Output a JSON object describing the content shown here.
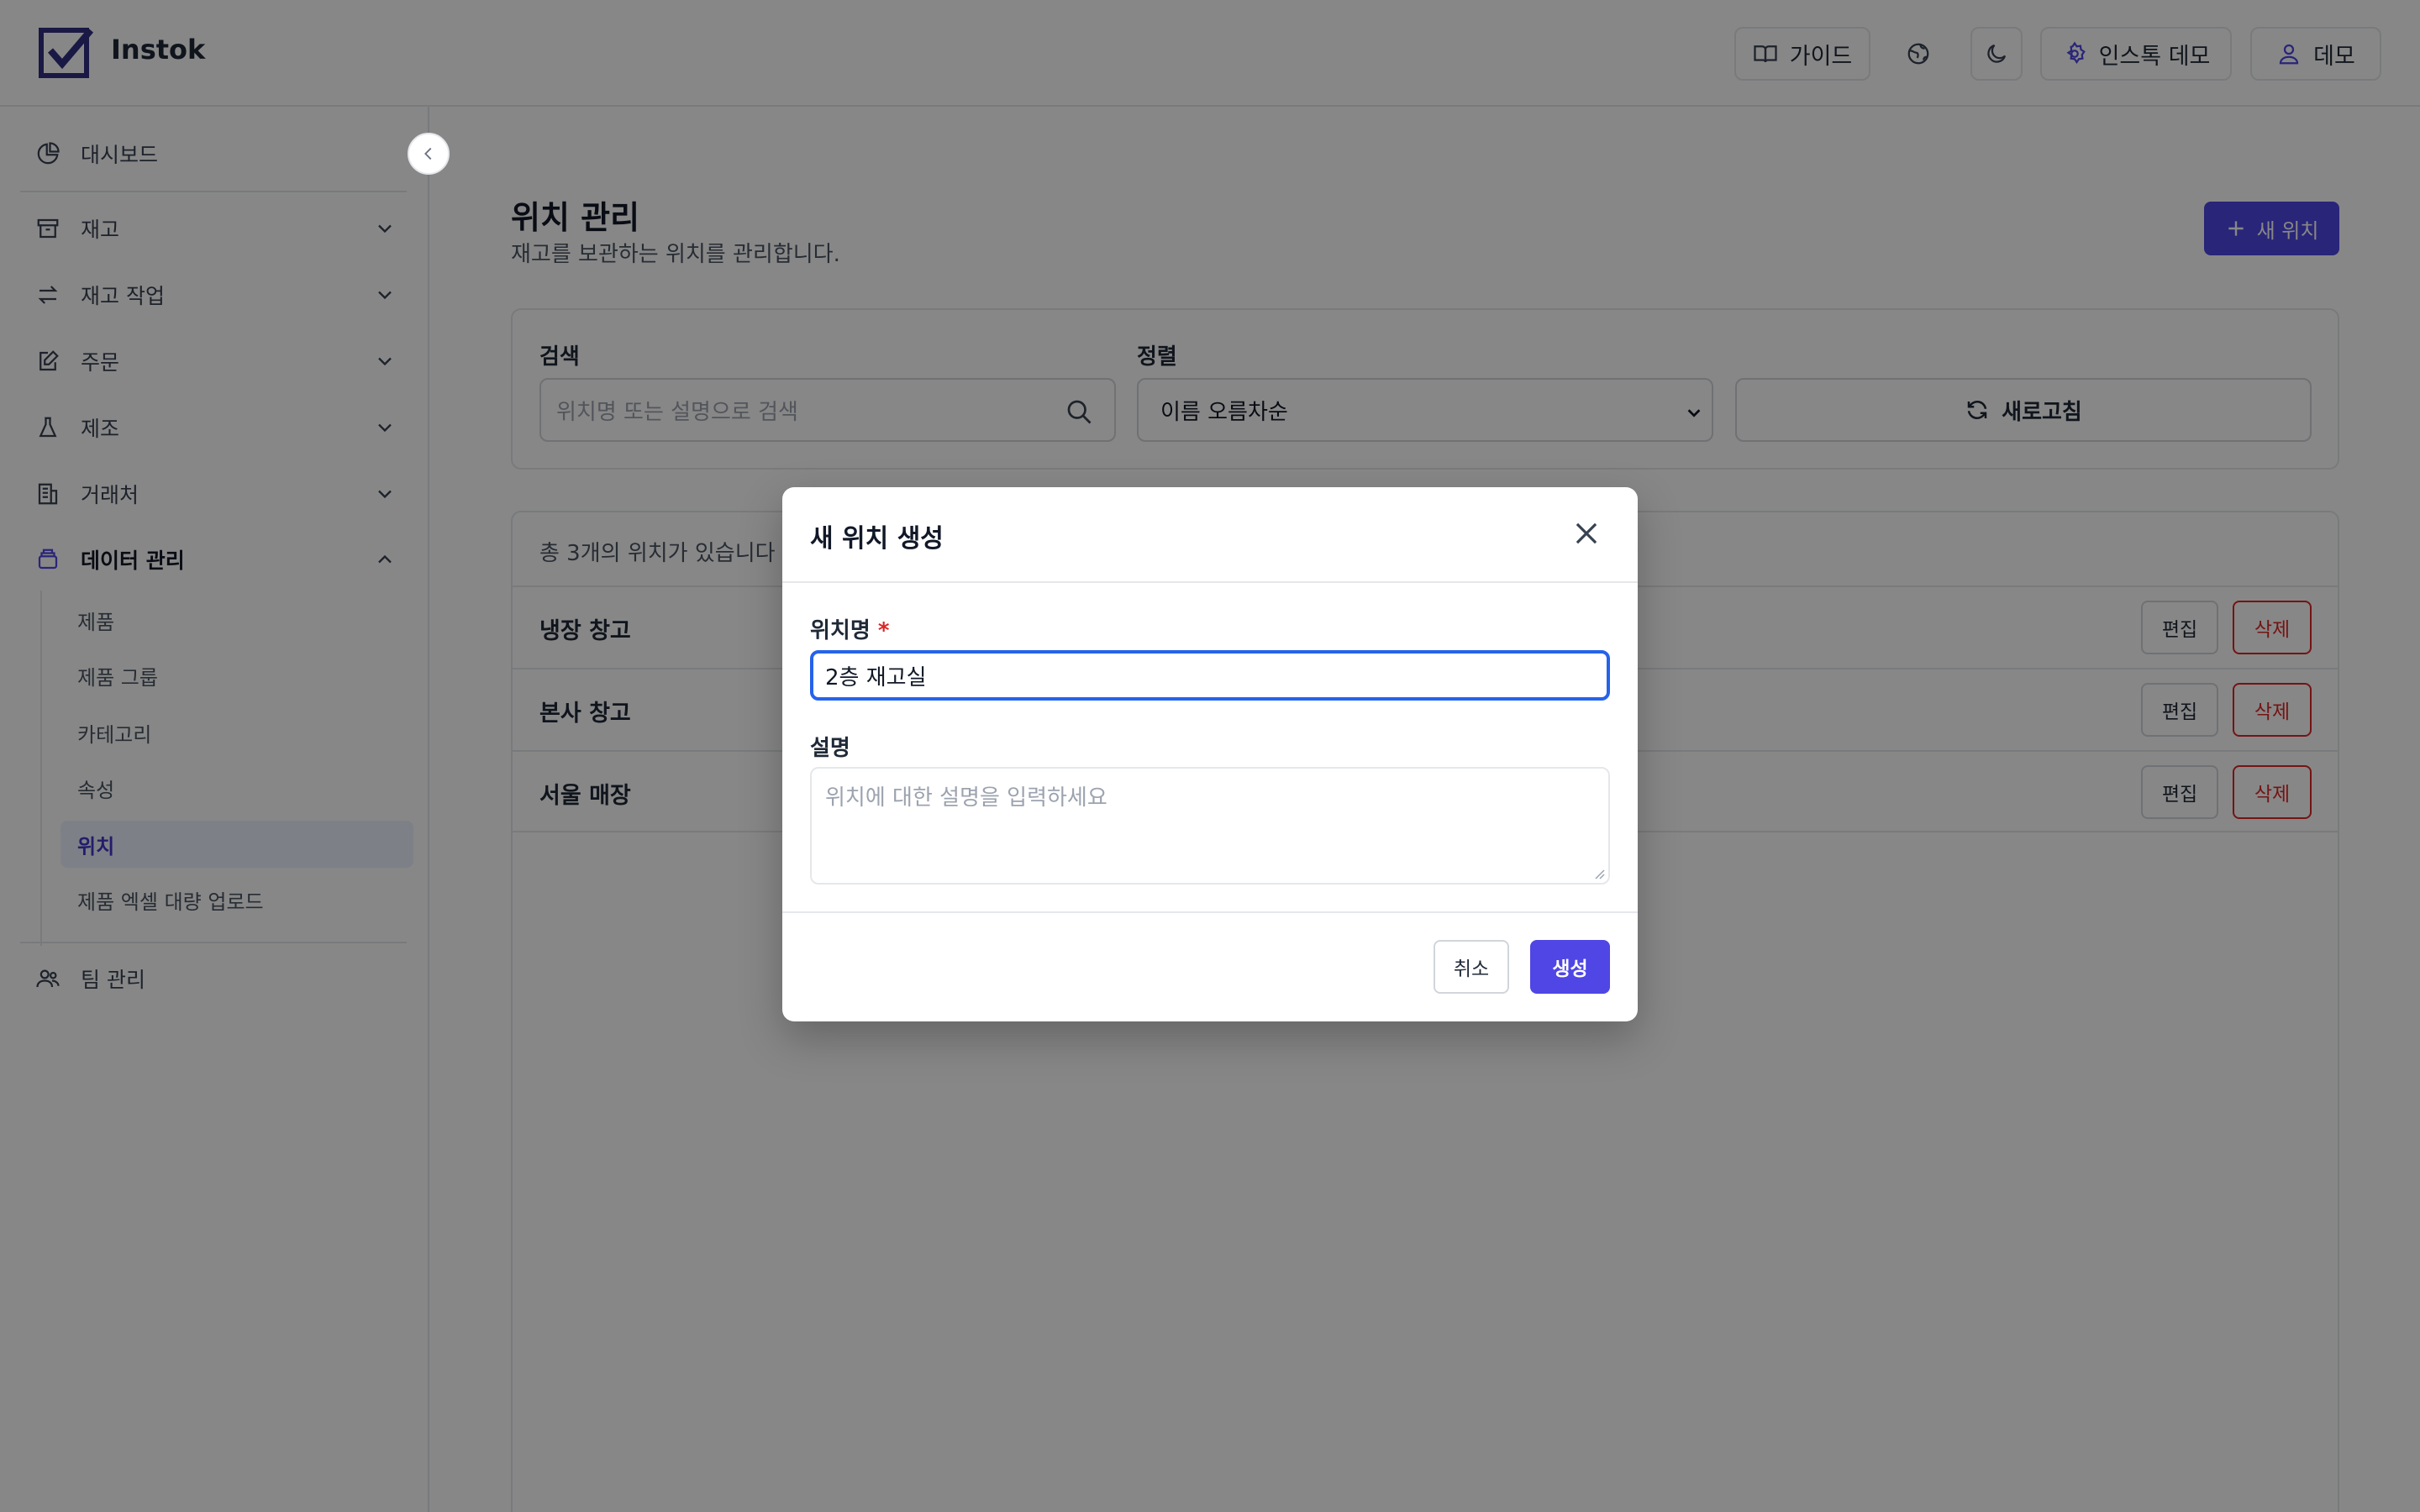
{
  "header": {
    "app_name": "Instok",
    "guide_label": "가이드",
    "workspace_label": "인스톡 데모",
    "user_label": "데모"
  },
  "sidebar": {
    "items": [
      {
        "label": "대시보드",
        "icon": "pie-chart-icon"
      },
      {
        "label": "재고",
        "icon": "archive-box-icon"
      },
      {
        "label": "재고 작업",
        "icon": "arrows-exchange-icon"
      },
      {
        "label": "주문",
        "icon": "edit-document-icon"
      },
      {
        "label": "제조",
        "icon": "flask-icon"
      },
      {
        "label": "거래처",
        "icon": "building-icon"
      },
      {
        "label": "데이터 관리",
        "icon": "database-icon"
      },
      {
        "label": "팀 관리",
        "icon": "users-icon"
      }
    ],
    "sub_items": [
      {
        "label": "제품"
      },
      {
        "label": "제품 그룹"
      },
      {
        "label": "카테고리"
      },
      {
        "label": "속성"
      },
      {
        "label": "위치"
      },
      {
        "label": "제품 엑셀 대량 업로드"
      }
    ],
    "active_sub_item": "위치"
  },
  "main": {
    "title": "위치 관리",
    "subtitle": "재고를 보관하는 위치를 관리합니다.",
    "new_button_label": "새 위치",
    "filters": {
      "search_label": "검색",
      "search_placeholder": "위치명 또는 설명으로 검색",
      "sort_label": "정렬",
      "sort_value": "이름 오름차순",
      "refresh_label": "새로고침"
    },
    "list": {
      "count_text": "총 3개의 위치가 있습니다",
      "rows": [
        {
          "name": "냉장 창고"
        },
        {
          "name": "본사 창고"
        },
        {
          "name": "서울 매장"
        }
      ],
      "edit_label": "편집",
      "delete_label": "삭제"
    }
  },
  "modal": {
    "title": "새 위치 생성",
    "name_label": "위치명",
    "required_mark": "*",
    "name_value": "2층 재고실",
    "desc_label": "설명",
    "desc_placeholder": "위치에 대한 설명을 입력하세요",
    "cancel_label": "취소",
    "create_label": "생성"
  },
  "colors": {
    "accent": "#4f46e5",
    "danger": "#dc2626",
    "focus": "#2563eb"
  }
}
